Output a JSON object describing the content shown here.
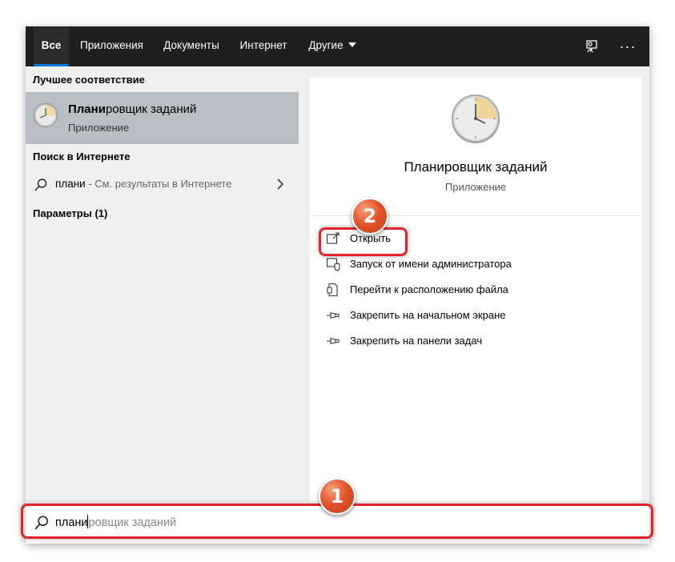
{
  "tabs": [
    {
      "label": "Все",
      "active": true
    },
    {
      "label": "Приложения"
    },
    {
      "label": "Документы"
    },
    {
      "label": "Интернет"
    },
    {
      "label": "Другие"
    }
  ],
  "accent_color": "#0078d7",
  "left": {
    "best_match_heading": "Лучшее соответствие",
    "best_match": {
      "name_bold": "Плани",
      "name_rest": "ровщик заданий",
      "type": "Приложение"
    },
    "web_heading": "Поиск в Интернете",
    "web_result": {
      "query": "плани",
      "rest": " - См. результаты в Интернете"
    },
    "settings_heading": "Параметры (1)"
  },
  "preview": {
    "title": "Планировщик заданий",
    "subtitle": "Приложение",
    "actions": [
      {
        "label": "Открыть",
        "icon": "open-window-icon"
      },
      {
        "label": "Запуск от имени администратора",
        "icon": "admin-shield-icon"
      },
      {
        "label": "Перейти к расположению файла",
        "icon": "file-location-icon"
      },
      {
        "label": "Закрепить на начальном экране",
        "icon": "pin-icon"
      },
      {
        "label": "Закрепить на панели задач",
        "icon": "pin-icon"
      }
    ]
  },
  "search": {
    "typed": "плани",
    "suggestion": "ровщик заданий"
  },
  "annotations": {
    "badge1": "1",
    "badge2": "2",
    "highlight_color": "#e3232a"
  }
}
